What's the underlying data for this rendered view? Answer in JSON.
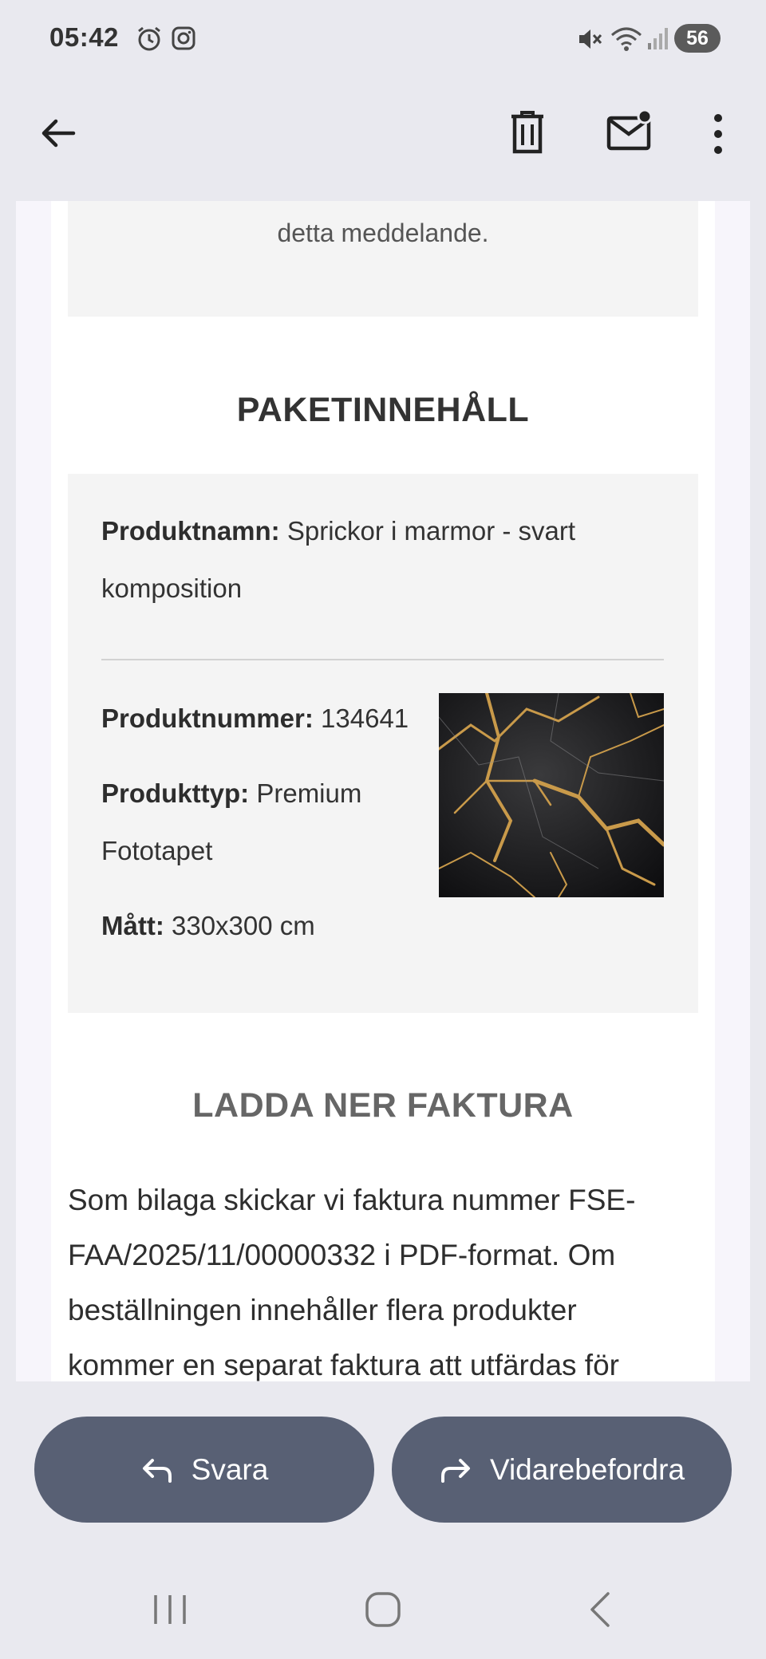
{
  "status_bar": {
    "time": "05:42",
    "battery": "56"
  },
  "app_bar": {
    "icons": [
      "back-arrow-icon",
      "trash-icon",
      "mark-unread-icon",
      "more-vert-icon"
    ]
  },
  "email": {
    "top_notice_text": "detta meddelande.",
    "package_heading": "PAKETINNEHÅLL",
    "product": {
      "name_label": "Produktnamn:",
      "name_value_line1": "Sprickor i marmor - svart",
      "name_value_line2": "komposition",
      "number_label": "Produktnummer:",
      "number_value": "134641",
      "type_label": "Produkttyp:",
      "type_value_line1": "Premium",
      "type_value_line2": "Fototapet",
      "size_label": "Mått:",
      "size_value": "330x300 cm",
      "image_desc": "black-gold-marble-thumbnail"
    },
    "invoice_heading": "LADDA NER FAKTURA",
    "invoice_lines": [
      "Som bilaga skickar vi faktura nummer FSE-",
      "FAA/2025/11/00000332 i PDF-format. Om",
      "beställningen innehåller flera produkter",
      "kommer en separat faktura att utfärdas för"
    ]
  },
  "actions": {
    "reply_label": "Svara",
    "forward_label": "Vidarebefordra"
  },
  "colors": {
    "button_bg": "#586074",
    "panel_bg": "#f4f4f4",
    "app_bg": "#e9e9ef"
  }
}
